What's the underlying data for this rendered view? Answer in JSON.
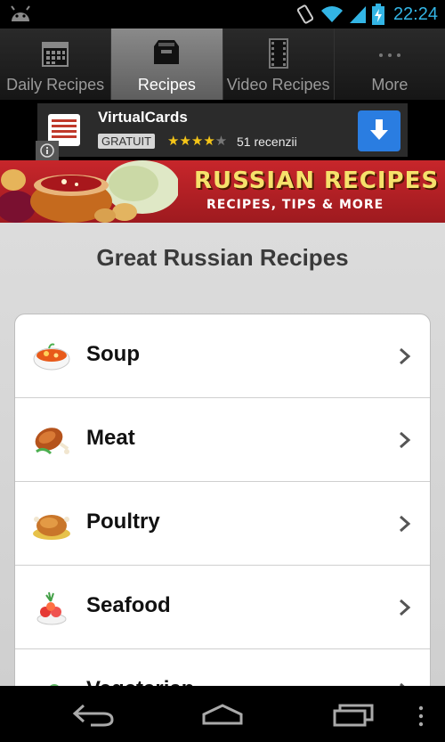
{
  "status_bar": {
    "time": "22:24"
  },
  "tabs": [
    {
      "label": "Daily Recipes",
      "icon": "calendar-icon",
      "active": false
    },
    {
      "label": "Recipes",
      "icon": "inbox-icon",
      "active": true
    },
    {
      "label": "Video Recipes",
      "icon": "film-icon",
      "active": false
    },
    {
      "label": "More",
      "icon": "more-dots-icon",
      "active": false
    }
  ],
  "ad": {
    "title": "VirtualCards",
    "badge": "GRATUIT",
    "rating": 4,
    "rating_max": 5,
    "reviews": "51 recenzii"
  },
  "banner": {
    "title": "RUSSIAN RECIPES",
    "subtitle": "RECIPES, TIPS & MORE"
  },
  "main": {
    "title": "Great Russian Recipes",
    "items": [
      {
        "label": "Soup",
        "icon": "soup-bowl-icon"
      },
      {
        "label": "Meat",
        "icon": "meat-drumstick-icon"
      },
      {
        "label": "Poultry",
        "icon": "roast-chicken-icon"
      },
      {
        "label": "Seafood",
        "icon": "seafood-dish-icon"
      },
      {
        "label": "Vegetarian",
        "icon": "vegetable-icon"
      }
    ]
  },
  "colors": {
    "status_time": "#33b5e5",
    "banner_red": "#c7262b",
    "banner_title": "#f6e16b",
    "ad_button": "#2a7de1"
  }
}
